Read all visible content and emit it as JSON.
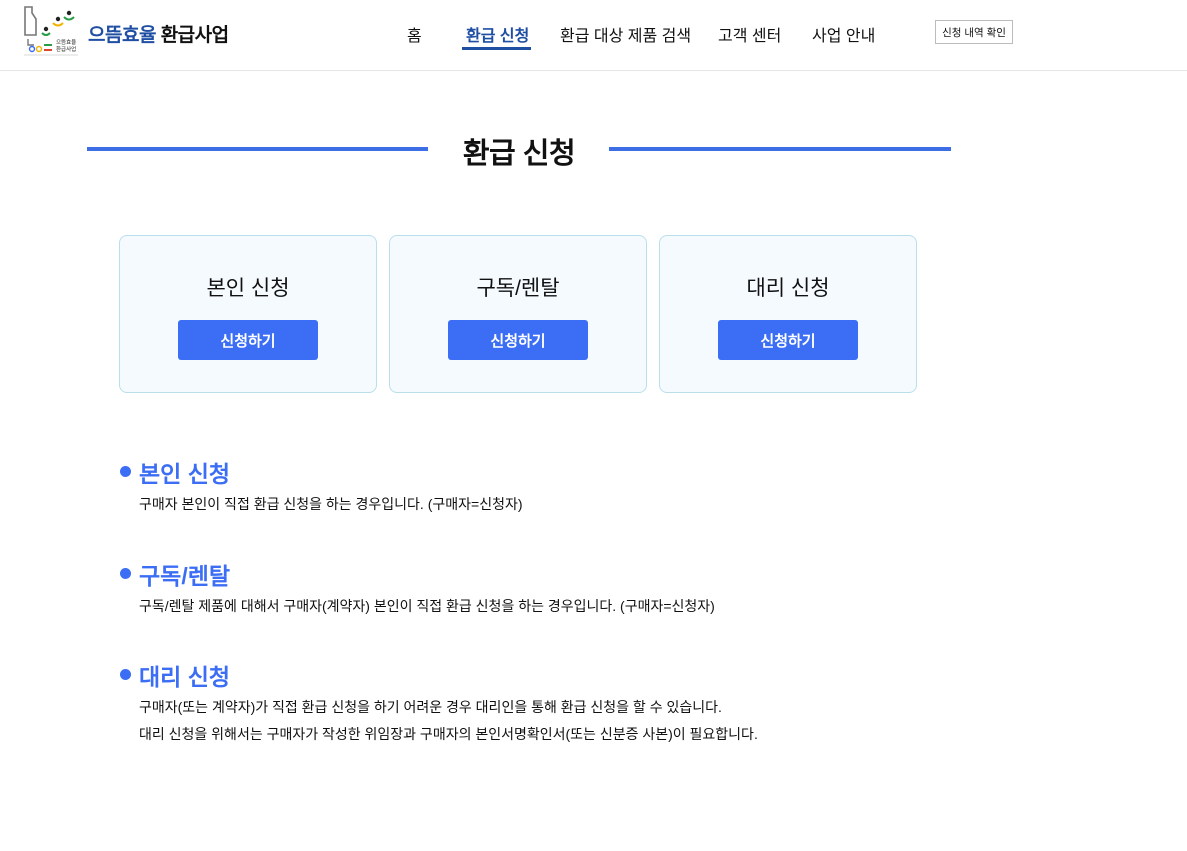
{
  "header": {
    "logo_small_text": [
      "으뜸효율",
      "환급사업"
    ],
    "brand_part1": "으뜸효율",
    "brand_part2": "환급사업",
    "nav": [
      {
        "label": "홈"
      },
      {
        "label": "환급 신청",
        "active": true
      },
      {
        "label": "환급 대상 제품 검색"
      },
      {
        "label": "고객 센터"
      },
      {
        "label": "사업 안내"
      }
    ],
    "history_button": "신청 내역 확인"
  },
  "page_title": "환급 신청",
  "cards": [
    {
      "title": "본인 신청",
      "button": "신청하기"
    },
    {
      "title": "구독/렌탈",
      "button": "신청하기"
    },
    {
      "title": "대리 신청",
      "button": "신청하기"
    }
  ],
  "sections": [
    {
      "title": "본인 신청",
      "lines": [
        "구매자 본인이 직접 환급 신청을 하는 경우입니다. (구매자=신청자)"
      ]
    },
    {
      "title": "구독/렌탈",
      "lines": [
        "구독/렌탈 제품에 대해서 구매자(계약자) 본인이 직접 환급 신청을 하는 경우입니다. (구매자=신청자)"
      ]
    },
    {
      "title": "대리 신청",
      "lines": [
        "구매자(또는 계약자)가 직접 환급 신청을 하기 어려운 경우 대리인을 통해 환급 신청을 할 수 있습니다.",
        "대리 신청을 위해서는 구매자가 작성한 위임장과 구매자의 본인서명확인서(또는 신분증 사본)이 필요합니다."
      ]
    }
  ],
  "colors": {
    "accent": "#3b6ef5",
    "brand": "#1f4fa3",
    "title_line": "#3e6ee6",
    "card_bg": "#f5faff",
    "card_border": "#b9dfea"
  }
}
